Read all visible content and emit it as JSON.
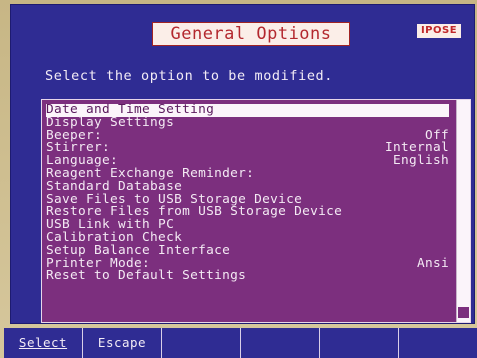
{
  "header": {
    "title": "General Options",
    "logo": "IPOSE"
  },
  "prompt": "Select the option to be modified.",
  "options": [
    {
      "label": "Date and Time Setting",
      "value": "",
      "selected": true
    },
    {
      "label": "Display Settings",
      "value": ""
    },
    {
      "label": "Beeper:",
      "value": "Off"
    },
    {
      "label": "Stirrer:",
      "value": "Internal"
    },
    {
      "label": "Language:",
      "value": "English"
    },
    {
      "label": "Reagent Exchange Reminder:",
      "value": ""
    },
    {
      "label": "Standard Database",
      "value": ""
    },
    {
      "label": "Save Files to USB Storage Device",
      "value": ""
    },
    {
      "label": "Restore Files from USB Storage Device",
      "value": ""
    },
    {
      "label": "USB Link with PC",
      "value": ""
    },
    {
      "label": "Calibration Check",
      "value": ""
    },
    {
      "label": "Setup Balance Interface",
      "value": ""
    },
    {
      "label": "Printer Mode:",
      "value": "Ansi"
    },
    {
      "label": "Reset to Default Settings",
      "value": ""
    }
  ],
  "softkeys": [
    "Select",
    "Escape",
    "",
    "",
    "",
    ""
  ],
  "colors": {
    "screen": "#2f2c93",
    "list": "#7c2f7e",
    "title_text": "#b3282e"
  }
}
